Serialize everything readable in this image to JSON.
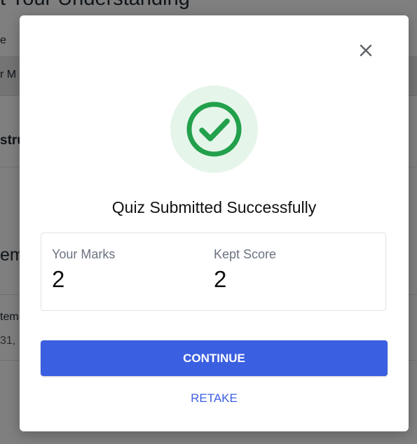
{
  "background": {
    "title_fragment": "t Your Understanding",
    "row1_fragment": "e",
    "row2_fragment": "r M",
    "row3_fragment": "stru",
    "row4_fragment": "emp",
    "row5_fragment": "tem",
    "row5_sub_fragment": "31,"
  },
  "modal": {
    "close_icon": "close-icon",
    "success_icon": "check-circle-icon",
    "title": "Quiz Submitted Successfully",
    "scores": {
      "your_marks_label": "Your Marks",
      "your_marks_value": "2",
      "kept_score_label": "Kept Score",
      "kept_score_value": "2"
    },
    "continue_label": "CONTINUE",
    "retake_label": "RETAKE"
  },
  "colors": {
    "primary": "#3a5fe0",
    "success": "#22a04b",
    "success_bg": "#e6f5ea",
    "overlay": "rgba(0,0,0,0.5)"
  }
}
